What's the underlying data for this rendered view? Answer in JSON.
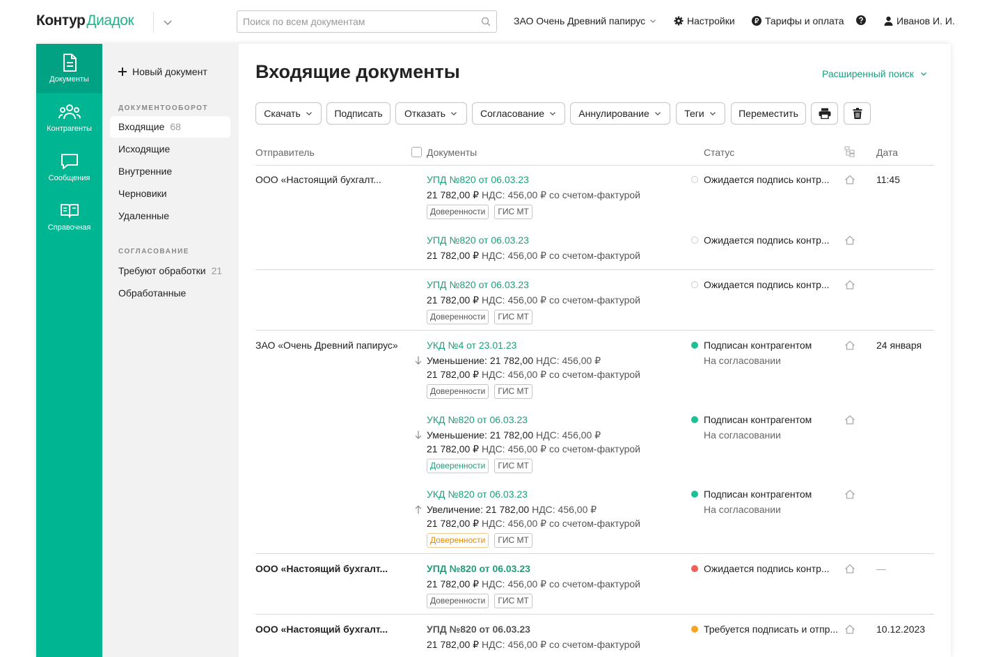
{
  "brand": {
    "part1": "Контур",
    "part2": "Диадок"
  },
  "search": {
    "placeholder": "Поиск по всем документам",
    "value": ""
  },
  "header": {
    "org": "ЗАО Очень Древний папирус",
    "settings": "Настройки",
    "tariffs": "Тарифы и оплата",
    "user": "Иванов И. И."
  },
  "rail": [
    {
      "label": "Документы",
      "icon": "document-icon"
    },
    {
      "label": "Контрагенты",
      "icon": "people-icon"
    },
    {
      "label": "Сообщения",
      "icon": "chat-icon"
    },
    {
      "label": "Справочная",
      "icon": "book-icon"
    }
  ],
  "nav": {
    "new_doc": "Новый документ",
    "section1": "ДОКУМЕНТООБОРОТ",
    "items1": [
      {
        "label": "Входящие",
        "count": "68"
      },
      {
        "label": "Исходящие"
      },
      {
        "label": "Внутренние"
      },
      {
        "label": "Черновики"
      },
      {
        "label": "Удаленные"
      }
    ],
    "section2": "СОГЛАСОВАНИЕ",
    "items2": [
      {
        "label": "Требуют обработки",
        "count": "21"
      },
      {
        "label": "Обработанные"
      }
    ]
  },
  "main": {
    "title": "Входящие документы",
    "adv_search": "Расширенный поиск",
    "toolbar": {
      "download": "Скачать",
      "sign": "Подписать",
      "refuse": "Отказать",
      "approval": "Согласование",
      "annul": "Аннулирование",
      "tags": "Теги",
      "move": "Переместить"
    },
    "columns": {
      "sender": "Отправитель",
      "documents": "Документы",
      "status": "Статус",
      "date": "Дата"
    }
  },
  "rows": [
    {
      "sender": "ООО «Настоящий бухгалт...",
      "date": "11:45",
      "title": "УПД №820 от 06.03.23",
      "sum": "21 782,00 ₽",
      "vat": "НДС: 456,00 ₽  со счетом-фактурой",
      "tag1": "Доверенности",
      "tag2": "ГИС МТ",
      "status": "Ожидается подпись контр..."
    },
    {
      "title": "УПД №820 от 06.03.23",
      "sum": "21 782,00 ₽",
      "vat": "НДС: 456,00 ₽  со счетом-фактурой",
      "status": "Ожидается подпись контр..."
    },
    {
      "title": "УПД №820 от 06.03.23",
      "sum": "21 782,00 ₽",
      "vat": "НДС: 456,00 ₽  со счетом-фактурой",
      "tag1": "Доверенности",
      "tag2": "ГИС МТ",
      "status": "Ожидается подпись контр..."
    },
    {
      "sender": "ЗАО «Очень Древний папирус»",
      "date": "24 января",
      "title": "УКД №4 от 23.01.23",
      "change": "Уменьшение: 21 782,00",
      "change_vat": "НДС: 456,00 ₽",
      "sum": "21 782,00 ₽",
      "vat": "НДС: 456,00 ₽  со счетом-фактурой",
      "tag1": "Доверенности",
      "tag2": "ГИС МТ",
      "status": "Подписан контрагентом",
      "status_sub": "На согласовании"
    },
    {
      "title": "УКД №820 от 06.03.23",
      "change": "Уменьшение: 21 782,00",
      "change_vat": "НДС: 456,00 ₽",
      "sum": "21 782,00 ₽",
      "vat": "НДС: 456,00 ₽  со счетом-фактурой",
      "tag1": "Доверенности",
      "tag2": "ГИС МТ",
      "status": "Подписан контрагентом",
      "status_sub": "На согласовании"
    },
    {
      "title": "УКД №820 от 06.03.23",
      "change": "Увеличение: 21 782,00",
      "change_vat": "НДС: 456,00 ₽",
      "sum": "21 782,00 ₽",
      "vat": "НДС: 456,00 ₽  со счетом-фактурой",
      "tag1": "Доверенности",
      "tag2": "ГИС МТ",
      "status": "Подписан контрагентом",
      "status_sub": "На согласовании"
    },
    {
      "sender": "ООО «Настоящий бухгалт...",
      "date": "—",
      "title": "УПД №820 от 06.03.23",
      "sum": "21 782,00 ₽",
      "vat": "НДС: 456,00 ₽  со счетом-фактурой",
      "tag1": "Доверенности",
      "tag2": "ГИС МТ",
      "status": "Ожидается подпись контр..."
    },
    {
      "sender": "ООО «Настоящий бухгалт...",
      "date": "10.12.2023",
      "title": "УПД №820 от 06.03.23",
      "sum": "21 782,00 ₽",
      "vat": "НДС: 456,00 ₽  со счетом-фактурой",
      "status": "Требуется подписать и отпр..."
    }
  ],
  "colors": {
    "accent": "#00b591",
    "link": "#1c9e7a",
    "dot_gray": "#dcdcdc",
    "dot_green": "#1fbf95",
    "dot_red": "#f0605a",
    "dot_orange": "#f5a623"
  }
}
